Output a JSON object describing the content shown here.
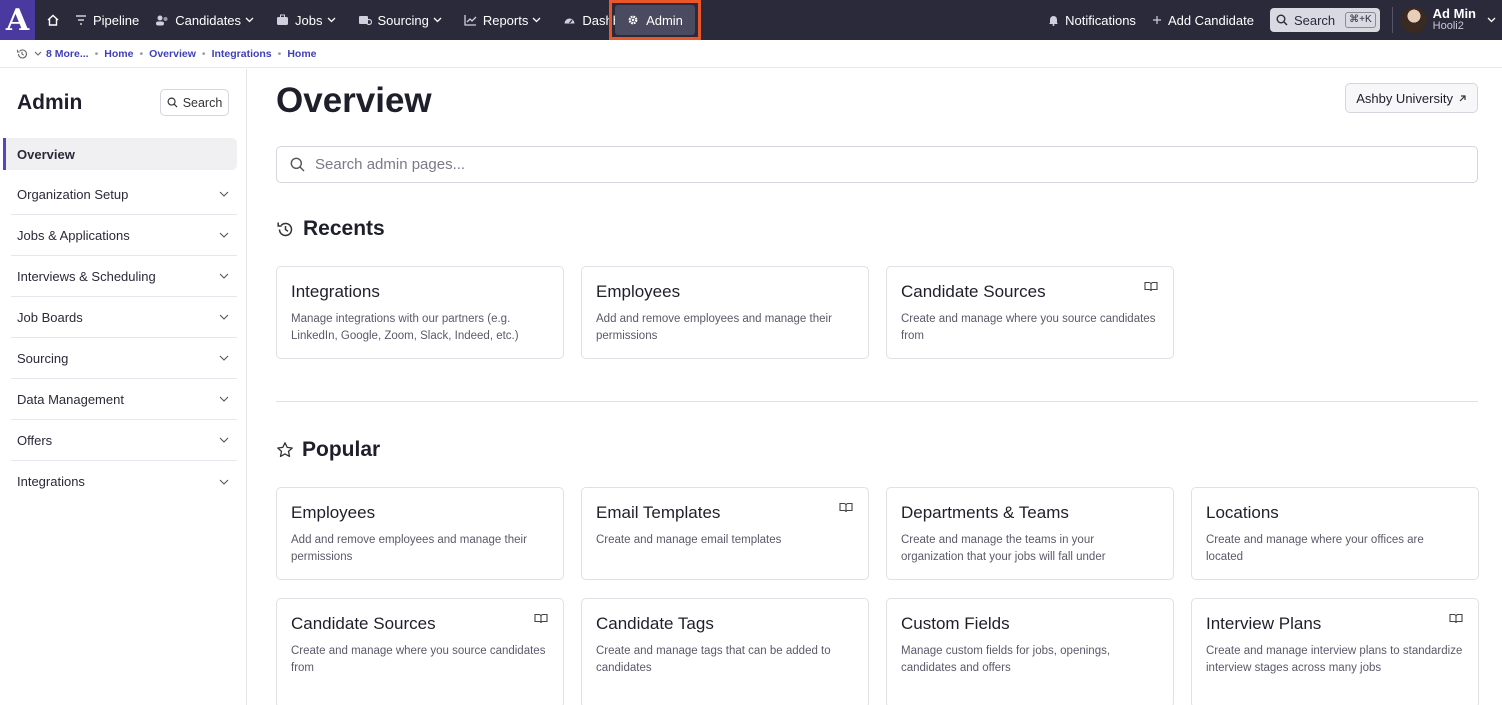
{
  "logo": "A",
  "nav": {
    "items": [
      {
        "label": "Pipeline",
        "has_chevron": false
      },
      {
        "label": "Candidates",
        "has_chevron": true
      },
      {
        "label": "Jobs",
        "has_chevron": true
      },
      {
        "label": "Sourcing",
        "has_chevron": true
      },
      {
        "label": "Reports",
        "has_chevron": true
      },
      {
        "label": "Dashboards",
        "has_chevron": true
      }
    ],
    "admin_label": "Admin",
    "notifications_label": "Notifications",
    "add_candidate_label": "Add Candidate",
    "search_label": "Search",
    "search_shortcut": "⌘+K",
    "user_name": "Ad Min",
    "user_org": "Hooli2",
    "colors": {
      "bar": "#2a2a3a",
      "logo": "#4a3aa0",
      "highlight": "#e8562a"
    }
  },
  "breadcrumb": {
    "more": "8 More...",
    "items": [
      "Home",
      "Overview",
      "Integrations",
      "Home"
    ]
  },
  "sidebar": {
    "title": "Admin",
    "search_label": "Search",
    "items": [
      {
        "label": "Overview",
        "active": true
      },
      {
        "label": "Organization Setup"
      },
      {
        "label": "Jobs & Applications"
      },
      {
        "label": "Interviews & Scheduling"
      },
      {
        "label": "Job Boards"
      },
      {
        "label": "Sourcing"
      },
      {
        "label": "Data Management"
      },
      {
        "label": "Offers"
      },
      {
        "label": "Integrations"
      }
    ]
  },
  "main": {
    "title": "Overview",
    "university_label": "Ashby University",
    "search_placeholder": "Search admin pages...",
    "recents_title": "Recents",
    "popular_title": "Popular",
    "recents": [
      {
        "title": "Integrations",
        "desc": "Manage integrations with our partners (e.g. LinkedIn, Google, Zoom, Slack, Indeed, etc.)",
        "book": false
      },
      {
        "title": "Employees",
        "desc": "Add and remove employees and manage their permissions",
        "book": false
      },
      {
        "title": "Candidate Sources",
        "desc": "Create and manage where you source candidates from",
        "book": true
      }
    ],
    "popular": [
      {
        "title": "Employees",
        "desc": "Add and remove employees and manage their permissions",
        "book": false
      },
      {
        "title": "Email Templates",
        "desc": "Create and manage email templates",
        "book": true
      },
      {
        "title": "Departments & Teams",
        "desc": "Create and manage the teams in your organization that your jobs will fall under",
        "book": false
      },
      {
        "title": "Locations",
        "desc": "Create and manage where your offices are located",
        "book": false
      },
      {
        "title": "Candidate Sources",
        "desc": "Create and manage where you source candidates from",
        "book": true
      },
      {
        "title": "Candidate Tags",
        "desc": "Create and manage tags that can be added to candidates",
        "book": false
      },
      {
        "title": "Custom Fields",
        "desc": "Manage custom fields for jobs, openings, candidates and offers",
        "book": false
      },
      {
        "title": "Interview Plans",
        "desc": "Create and manage interview plans to standardize interview stages across many jobs",
        "book": true
      }
    ]
  }
}
